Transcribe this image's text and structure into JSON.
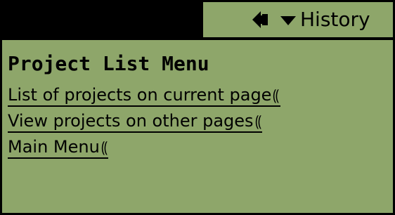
{
  "titlebar": {
    "menu_label": "History",
    "back_icon": "back-arrow-icon",
    "dropdown_icon": "chevron-down-icon"
  },
  "main": {
    "heading": "Project List Menu",
    "links": [
      {
        "label": "List of projects on current page",
        "icon": "link-icon"
      },
      {
        "label": "View projects on other pages",
        "icon": "link-icon"
      },
      {
        "label": "Main Menu",
        "icon": "link-icon"
      }
    ]
  },
  "colors": {
    "background": "#8ea66a",
    "foreground": "#000000"
  }
}
